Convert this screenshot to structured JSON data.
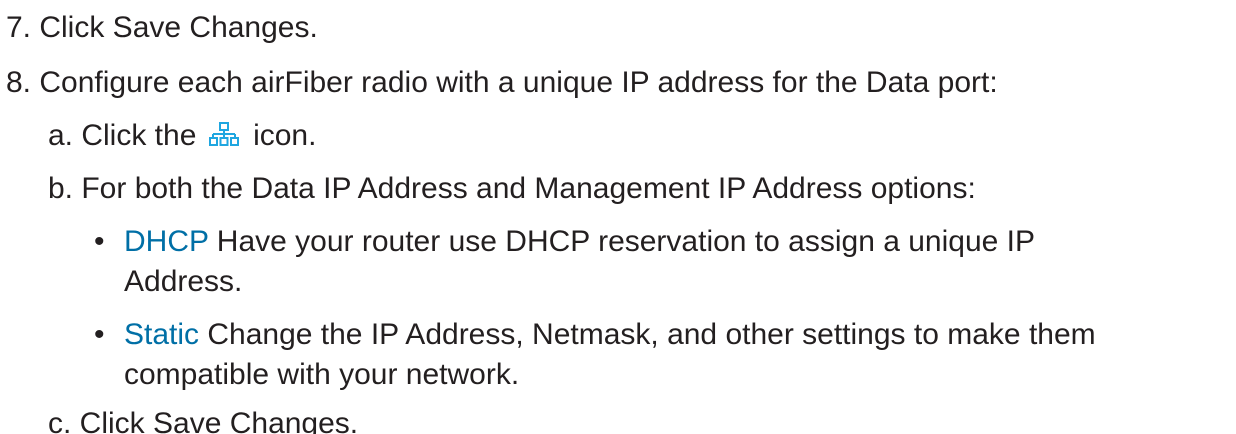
{
  "steps": {
    "step7": "7. Click Save Changes.",
    "step8": "8. Configure each airFiber radio with a unique IP address for the Data port:",
    "sub_a_prefix": "a. Click the",
    "sub_a_suffix": "icon.",
    "sub_a_icon": "network-icon",
    "sub_b": "b. For both the Data IP Address and Management IP Address options:",
    "bullet_char": "•",
    "dhcp_label": "DHCP",
    "dhcp_text_line1": " Have your router use DHCP reservation to assign a unique IP",
    "dhcp_text_line2": "Address.",
    "static_label": "Static",
    "static_text_line1": " Change the IP Address, Netmask, and other settings to make them",
    "static_text_line2": "compatible with your network.",
    "sub_c": "c. Click Save Changes."
  },
  "colors": {
    "accent": "#006fa6",
    "text": "#231f20",
    "icon": "#1fa6e0"
  }
}
